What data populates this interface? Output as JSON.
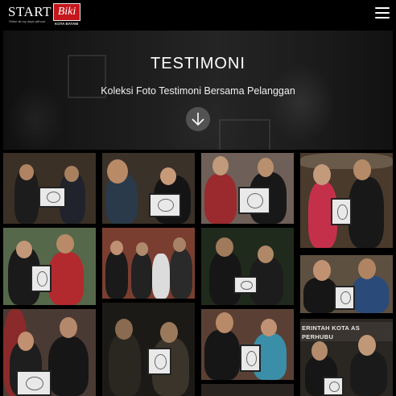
{
  "header": {
    "logo": {
      "start": "START",
      "biki": "Biki",
      "tagline": "Strike all my days without",
      "city": "KOTA BATAM"
    },
    "menu_icon": "hamburger-menu-icon"
  },
  "hero": {
    "title": "TESTIMONI",
    "subtitle": "Koleksi Foto Testimoni Bersama Pelanggan",
    "scroll_icon": "arrow-down-icon"
  },
  "gallery": {
    "photos": [
      {
        "name": "testimoni-photo-1",
        "tone": "#5a4a3a"
      },
      {
        "name": "testimoni-photo-2",
        "tone": "#4a4236"
      },
      {
        "name": "testimoni-photo-3",
        "tone": "#6b5d52"
      },
      {
        "name": "testimoni-photo-4",
        "tone": "#3d2e22"
      },
      {
        "name": "testimoni-photo-5",
        "tone": "#5e6a52"
      },
      {
        "name": "testimoni-photo-6",
        "tone": "#6b3e32"
      },
      {
        "name": "testimoni-photo-7",
        "tone": "#2e3a2a"
      },
      {
        "name": "testimoni-photo-8",
        "tone": "#4a3e30"
      },
      {
        "name": "testimoni-photo-9",
        "tone": "#5a3e44"
      },
      {
        "name": "testimoni-photo-10",
        "tone": "#3a3020"
      },
      {
        "name": "testimoni-photo-11",
        "tone": "#5e5448"
      },
      {
        "name": "testimoni-photo-12",
        "tone": "#3e3226"
      },
      {
        "name": "testimoni-photo-13",
        "tone": "#2a2622"
      }
    ],
    "sign_text": "ERINTAH KOTA AS PERHUBU"
  }
}
